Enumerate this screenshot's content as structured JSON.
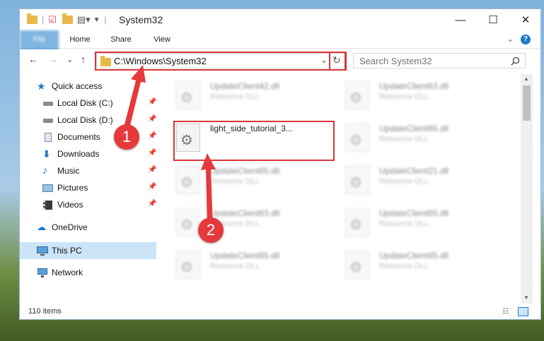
{
  "window": {
    "title": "System32",
    "controls": {
      "minimize": "—",
      "maximize": "☐",
      "close": "✕"
    }
  },
  "ribbon": {
    "tabs": [
      {
        "label": "File"
      },
      {
        "label": "Home"
      },
      {
        "label": "Share"
      },
      {
        "label": "View"
      }
    ],
    "collapse": "⌄",
    "help": "?"
  },
  "address": {
    "path": "C:\\Windows\\System32",
    "dropdown": "⌄",
    "refresh": "↻"
  },
  "search": {
    "placeholder": "Search System32",
    "icon": "magnifier"
  },
  "nav": {
    "back": "←",
    "forward": "→",
    "recent": "⌄",
    "up": "↑"
  },
  "sidebar": {
    "items": [
      {
        "label": "Quick access",
        "icon": "star-icon"
      },
      {
        "label": "Local Disk (C:)",
        "icon": "drive-icon",
        "pinned": true
      },
      {
        "label": "Local Disk (D:)",
        "icon": "drive-icon",
        "pinned": true
      },
      {
        "label": "Documents",
        "icon": "documents-icon",
        "pinned": true
      },
      {
        "label": "Downloads",
        "icon": "download-icon",
        "pinned": true
      },
      {
        "label": "Music",
        "icon": "music-icon",
        "pinned": true
      },
      {
        "label": "Pictures",
        "icon": "pictures-icon",
        "pinned": true
      },
      {
        "label": "Videos",
        "icon": "videos-icon",
        "pinned": true
      },
      {
        "label": "OneDrive",
        "icon": "cloud-icon"
      },
      {
        "label": "This PC",
        "icon": "computer-icon",
        "selected": true
      },
      {
        "label": "Network",
        "icon": "network-icon"
      }
    ]
  },
  "files": [
    {
      "name": "UpdateClient42.dll",
      "type": "Resource DLL"
    },
    {
      "name": "UpdateClient63.dll",
      "type": "Resource DLL"
    },
    {
      "name": "light_side_tutorial_3...",
      "type": ""
    },
    {
      "name": "UpdateClient65.dll",
      "type": "Resource DLL"
    },
    {
      "name": "UpdateClient65.dll",
      "type": "Resource DLL"
    },
    {
      "name": "UpdateClient21.dll",
      "type": "Resource DLL"
    },
    {
      "name": "UpdateClient63.dll",
      "type": "Resource DLL"
    },
    {
      "name": "UpdateClient65.dll",
      "type": "Resource DLL"
    },
    {
      "name": "UpdateClient65.dll",
      "type": "Resource DLL"
    },
    {
      "name": "UpdateClient65.dll",
      "type": "Resource DLL"
    }
  ],
  "status": {
    "count": "110 items"
  },
  "annotations": {
    "badge1": "1",
    "badge2": "2"
  },
  "colors": {
    "accent": "#1979ca",
    "highlight": "#d9353a",
    "selection": "#cce4f7"
  }
}
